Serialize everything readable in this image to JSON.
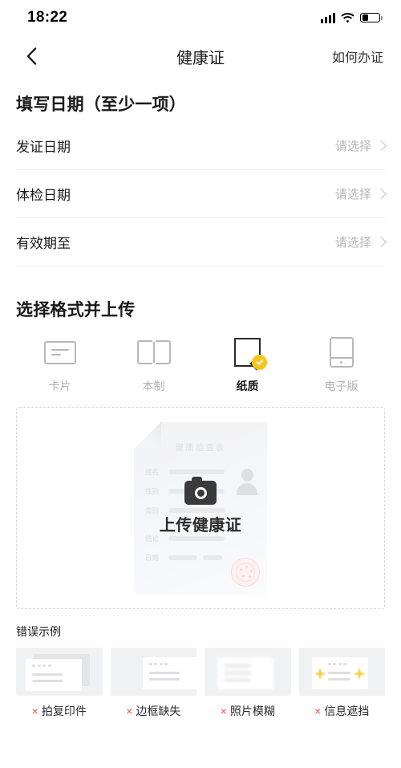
{
  "status_bar": {
    "time": "18:22",
    "signal_icon": "signal-bars-icon",
    "wifi_icon": "wifi-icon",
    "battery_icon": "battery-icon",
    "battery_level_pct": 38
  },
  "nav": {
    "back_icon": "chevron-left-icon",
    "title": "健康证",
    "action_label": "如何办证"
  },
  "date_section": {
    "title": "填写日期（至少一项）",
    "rows": [
      {
        "label": "发证日期",
        "value": "请选择"
      },
      {
        "label": "体检日期",
        "value": "请选择"
      },
      {
        "label": "有效期至",
        "value": "请选择"
      }
    ]
  },
  "format_section": {
    "title": "选择格式并上传",
    "options": [
      {
        "label": "卡片",
        "icon": "card-icon",
        "selected": false
      },
      {
        "label": "本制",
        "icon": "book-icon",
        "selected": false
      },
      {
        "label": "纸质",
        "icon": "paper-icon",
        "selected": true
      },
      {
        "label": "电子版",
        "icon": "phone-icon",
        "selected": false
      }
    ],
    "selected_badge_color": "#F7C51E"
  },
  "upload": {
    "camera_icon": "camera-icon",
    "cta_label": "上传健康证",
    "document_preview": {
      "heading": "健康检查表",
      "fields": [
        "姓名",
        "性别",
        "类别",
        "结论",
        "日期"
      ],
      "avatar_icon": "person-avatar-icon",
      "stamp_icon": "red-seal-stamp-icon"
    }
  },
  "error_section": {
    "title": "错误示例",
    "x_mark": "×",
    "x_color": "#e8504a",
    "items": [
      {
        "label": "拍复印件",
        "thumb": "photocopy-thumb"
      },
      {
        "label": "边框缺失",
        "thumb": "cropped-border-thumb"
      },
      {
        "label": "照片模糊",
        "thumb": "blurry-photo-thumb"
      },
      {
        "label": "信息遮挡",
        "thumb": "obscured-info-thumb"
      }
    ]
  }
}
